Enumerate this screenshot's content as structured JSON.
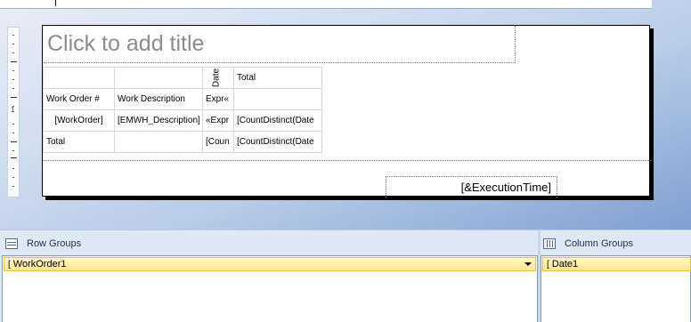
{
  "report": {
    "title_placeholder": "Click to add title",
    "execution_time": "[&ExecutionTime]"
  },
  "tablix": {
    "header_row": {
      "col3_rotated": "Date",
      "col4": "Total"
    },
    "label_row": {
      "col1": "Work Order #",
      "col2": "Work Description",
      "col3": "Expr«",
      "col4": ""
    },
    "detail_row": {
      "col1": "[WorkOrder]",
      "col2": "[EMWH_Description]",
      "col3": "«Expr",
      "col4": "[CountDistinct(Date"
    },
    "total_row": {
      "col1": "Total",
      "col2": "",
      "col3": "[Coun",
      "col4": "[CountDistinct(Date"
    }
  },
  "ruler": {
    "number": "1"
  },
  "row_groups": {
    "label": "Row Groups",
    "items": [
      {
        "name": "WorkOrder1",
        "bracket": "["
      }
    ]
  },
  "column_groups": {
    "label": "Column Groups",
    "items": [
      {
        "name": "Date1",
        "bracket": "["
      }
    ]
  },
  "icons": {
    "row_groups": "row-groups-icon",
    "column_groups": "column-groups-icon",
    "dropdown": "chevron-down-icon"
  },
  "colors": {
    "selected_group_fill": "#ffe48e",
    "pane_background": "#dfe8f5",
    "placeholder_text": "#8c8c8c"
  }
}
